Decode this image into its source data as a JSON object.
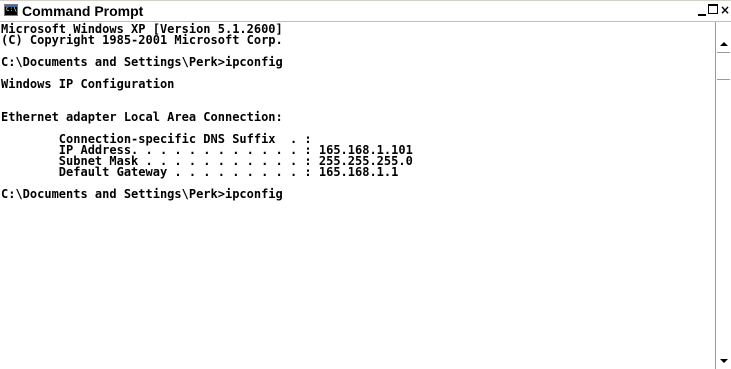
{
  "window": {
    "title": "Command Prompt",
    "icon": "console-icon",
    "controls": {
      "minimize": "_",
      "maximize": "□",
      "close": "×"
    }
  },
  "console": {
    "lines": [
      "Microsoft Windows XP [Version 5.1.2600]",
      "(C) Copyright 1985-2001 Microsoft Corp.",
      "",
      "C:\\Documents and Settings\\Perk>ipconfig",
      "",
      "Windows IP Configuration",
      "",
      "",
      "Ethernet adapter Local Area Connection:",
      "",
      "        Connection-specific DNS Suffix  . :",
      "        IP Address. . . . . . . . . . . . : 165.168.1.101",
      "        Subnet Mask . . . . . . . . . . . : 255.255.255.0",
      "        Default Gateway . . . . . . . . . : 165.168.1.1",
      "",
      "C:\\Documents and Settings\\Perk>ipconfig"
    ]
  },
  "scrollbar": {
    "up_icon": "arrow-up-icon",
    "down_icon": "arrow-down-icon"
  }
}
